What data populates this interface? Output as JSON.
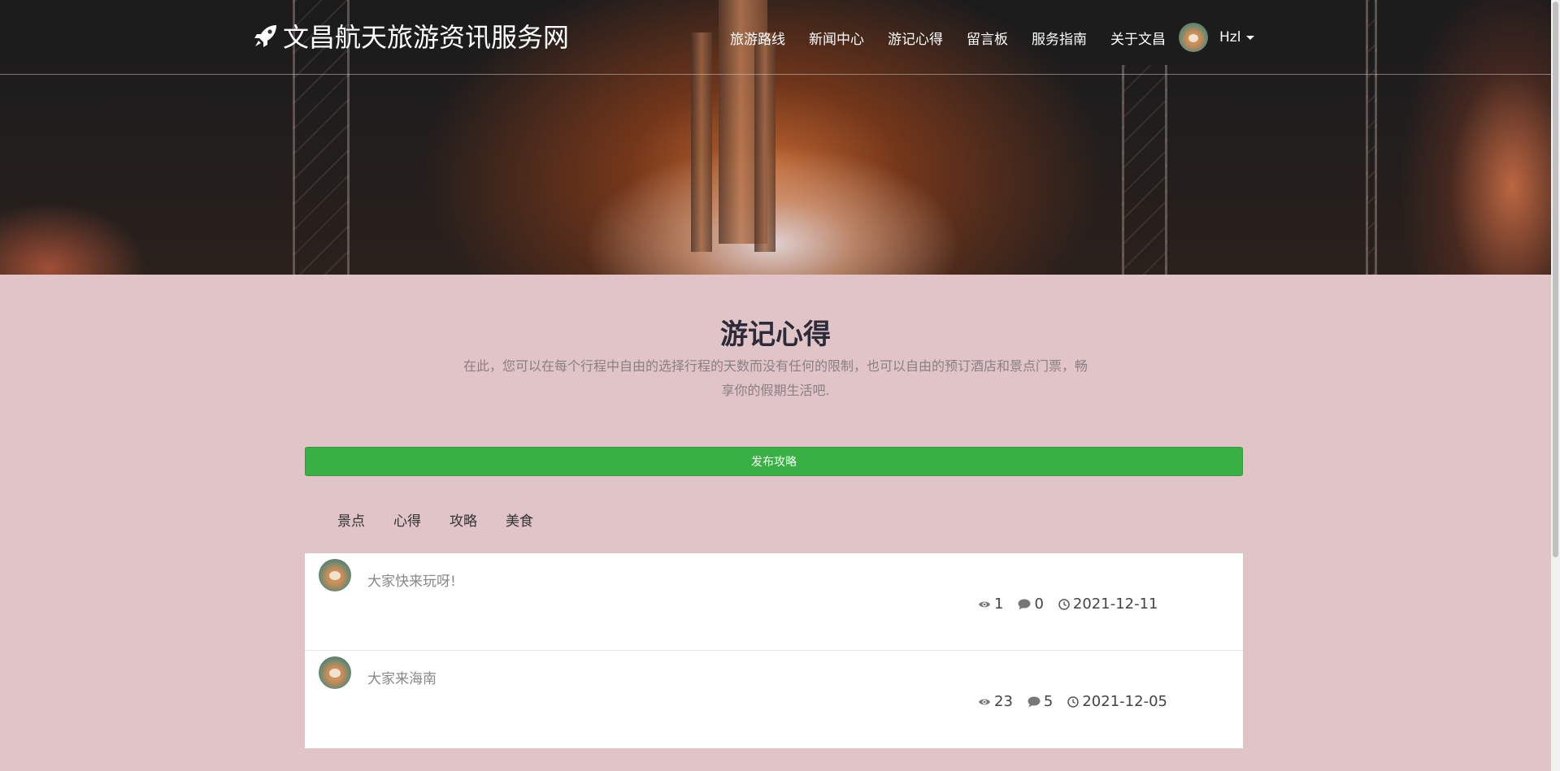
{
  "brand": {
    "title": "文昌航天旅游资讯服务网",
    "icon": "rocket-icon"
  },
  "nav": {
    "items": [
      {
        "label": "旅游路线"
      },
      {
        "label": "新闻中心"
      },
      {
        "label": "游记心得"
      },
      {
        "label": "留言板"
      },
      {
        "label": "服务指南"
      },
      {
        "label": "关于文昌"
      }
    ],
    "user": {
      "name": "Hzl",
      "icon": "caret-down-icon"
    }
  },
  "section": {
    "title": "游记心得",
    "description": "在此，您可以在每个行程中自由的选择行程的天数而没有任何的限制，也可以自由的预订酒店和景点门票，畅享你的假期生活吧."
  },
  "publish_button": {
    "label": "发布攻略"
  },
  "tabs": [
    {
      "label": "景点"
    },
    {
      "label": "心得"
    },
    {
      "label": "攻略"
    },
    {
      "label": "美食"
    }
  ],
  "posts": [
    {
      "title": "大家快来玩呀!",
      "views": "1",
      "comments": "0",
      "date": "2021-12-11"
    },
    {
      "title": "大家来海南",
      "views": "23",
      "comments": "5",
      "date": "2021-12-05"
    }
  ],
  "colors": {
    "background": "#e0c4c7",
    "publish_button": "#38b044",
    "title": "#2b2b3a"
  }
}
